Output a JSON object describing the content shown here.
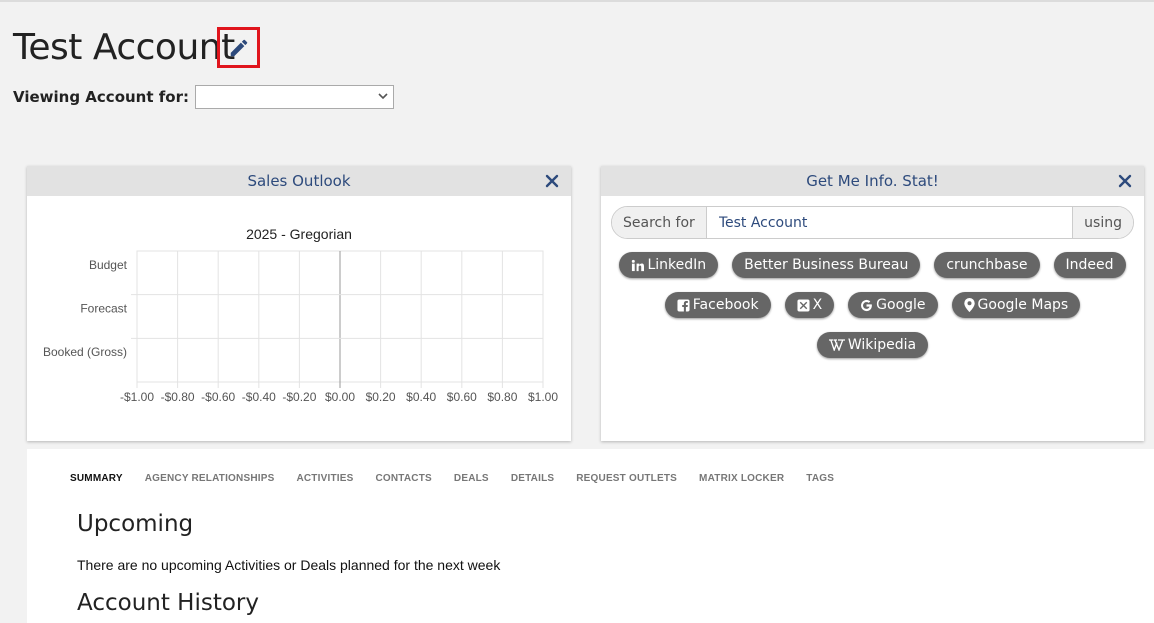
{
  "page": {
    "title": "Test Account",
    "viewing_label": "Viewing Account for:",
    "viewing_value": ""
  },
  "colors": {
    "accent": "#2d4a7c",
    "highlight": "#e0151d",
    "chip": "#666666"
  },
  "sales_panel": {
    "title": "Sales Outlook"
  },
  "chart_data": {
    "type": "bar",
    "orientation": "horizontal",
    "title": "2025 - Gregorian",
    "categories": [
      "Budget",
      "Forecast",
      "Booked (Gross)"
    ],
    "values": [
      0,
      0,
      0
    ],
    "xlim": [
      -1.0,
      1.0
    ],
    "xticks": [
      "-$1.00",
      "-$0.80",
      "-$0.60",
      "-$0.40",
      "-$0.20",
      "$0.00",
      "$0.20",
      "$0.40",
      "$0.60",
      "$0.80",
      "$1.00"
    ],
    "grid": true
  },
  "info_panel": {
    "title": "Get Me Info. Stat!",
    "search_prefix": "Search for",
    "search_value": "Test Account",
    "search_suffix": "using",
    "chips": [
      [
        {
          "label": "LinkedIn",
          "icon": "linkedin-icon"
        },
        {
          "label": "Better Business Bureau",
          "icon": ""
        },
        {
          "label": "crunchbase",
          "icon": ""
        },
        {
          "label": "Indeed",
          "icon": ""
        }
      ],
      [
        {
          "label": "Facebook",
          "icon": "facebook-icon"
        },
        {
          "label": "X",
          "icon": "x-icon"
        },
        {
          "label": "Google",
          "icon": "google-icon"
        },
        {
          "label": "Google Maps",
          "icon": "map-pin-icon"
        }
      ],
      [
        {
          "label": "Wikipedia",
          "icon": "wikipedia-icon"
        }
      ]
    ]
  },
  "main": {
    "tabs": [
      {
        "label": "SUMMARY",
        "active": true
      },
      {
        "label": "AGENCY RELATIONSHIPS",
        "active": false
      },
      {
        "label": "ACTIVITIES",
        "active": false
      },
      {
        "label": "CONTACTS",
        "active": false
      },
      {
        "label": "DEALS",
        "active": false
      },
      {
        "label": "DETAILS",
        "active": false
      },
      {
        "label": "REQUEST OUTLETS",
        "active": false
      },
      {
        "label": "MATRIX LOCKER",
        "active": false
      },
      {
        "label": "TAGS",
        "active": false
      }
    ],
    "upcoming_title": "Upcoming",
    "upcoming_text": "There are no upcoming Activities or Deals planned for the next week",
    "history_title": "Account History"
  }
}
